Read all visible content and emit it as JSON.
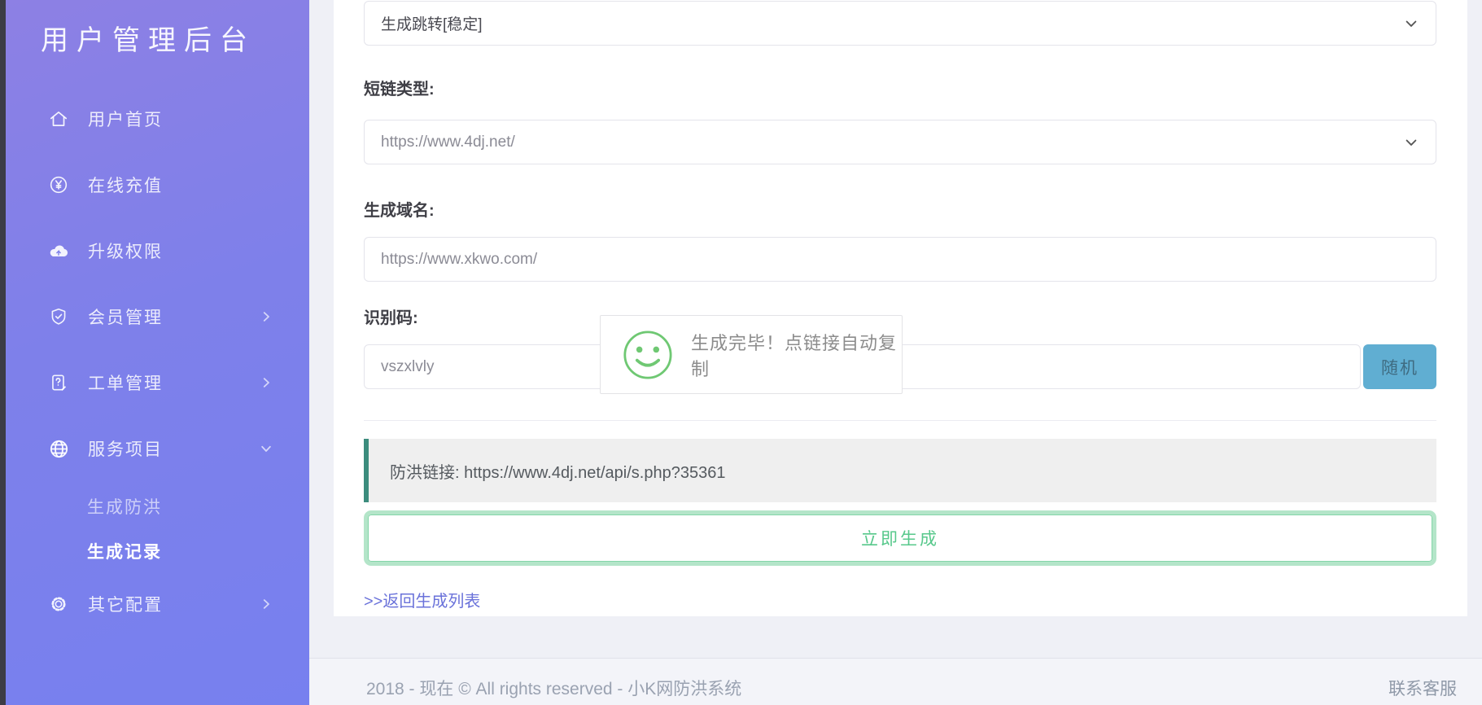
{
  "sidebar": {
    "title": "用户管理后台",
    "items": [
      {
        "label": "用户首页",
        "icon": "home-icon"
      },
      {
        "label": "在线充值",
        "icon": "yen-circle-icon"
      },
      {
        "label": "升级权限",
        "icon": "cloud-upload-icon"
      },
      {
        "label": "会员管理",
        "icon": "shield-check-icon",
        "chevron": "right"
      },
      {
        "label": "工单管理",
        "icon": "ticket-doc-icon",
        "chevron": "right"
      },
      {
        "label": "服务项目",
        "icon": "globe-icon",
        "chevron": "down",
        "expanded": true
      },
      {
        "label": "生成防洪",
        "sub": true
      },
      {
        "label": "生成记录",
        "sub": true,
        "active": true
      },
      {
        "label": "其它配置",
        "icon": "gear-icon",
        "chevron": "right"
      }
    ]
  },
  "form": {
    "mode_select": {
      "value": "生成跳转[稳定]"
    },
    "short_link_type": {
      "label": "短链类型:",
      "value": "https://www.4dj.net/"
    },
    "domain": {
      "label": "生成域名:",
      "value": "https://www.xkwo.com/"
    },
    "code": {
      "label": "识别码:",
      "value": "vszxlvly",
      "random_button_label": "随机"
    }
  },
  "toast": {
    "icon": "smiley-icon",
    "message": "生成完毕！点链接自动复制"
  },
  "result": {
    "text": "防洪链接: https://www.4dj.net/api/s.php?35361"
  },
  "generate_button_label": "立即生成",
  "back_link_label": ">>返回生成列表",
  "footer": {
    "copyright": "2018 - 现在 © All rights reserved - 小K网防洪系统",
    "contact": "联系客服"
  },
  "colors": {
    "sidebar_gradient_top": "#8d80e4",
    "sidebar_gradient_bottom": "#7780ef",
    "page_background": "#eff0f6",
    "alert_accent_teal": "#3c8c7d",
    "generate_border_green": "#b4e5c9",
    "generate_text_green": "#57c88b",
    "random_button_blue": "#60aed2",
    "link_purple": "#6a72da",
    "toast_smiley_green": "#6fc873"
  }
}
